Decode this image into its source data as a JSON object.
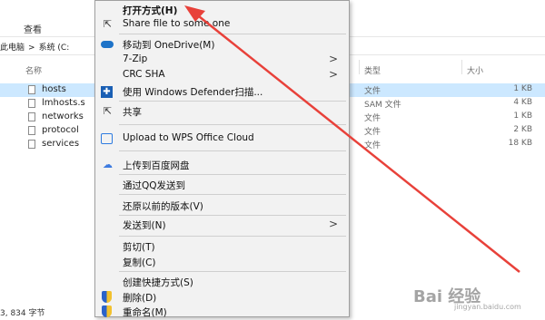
{
  "explorer": {
    "ribbon_tab": "查看",
    "breadcrumb": [
      "此电脑",
      ">",
      "系统 (C:"
    ],
    "columns": {
      "name": "名称",
      "type": "类型",
      "size": "大小"
    },
    "files": [
      {
        "name": "hosts",
        "type": "文件",
        "size": "1 KB",
        "selected": true
      },
      {
        "name": "lmhosts.s",
        "type": "SAM 文件",
        "size": "4 KB",
        "selected": false
      },
      {
        "name": "networks",
        "type": "文件",
        "size": "1 KB",
        "selected": false
      },
      {
        "name": "protocol",
        "type": "文件",
        "size": "2 KB",
        "selected": false
      },
      {
        "name": "services",
        "type": "文件",
        "size": "18 KB",
        "selected": false
      }
    ],
    "status": "3, 834 字节"
  },
  "context_menu": {
    "items": [
      {
        "label": "打开方式(H)",
        "icon": "none",
        "bold": true
      },
      {
        "label": "Share file to some one",
        "icon": "share-icon"
      },
      {
        "label": "移动到 OneDrive(M)",
        "icon": "onedrive-icon"
      },
      {
        "label": "7-Zip",
        "icon": "none",
        "submenu": true
      },
      {
        "label": "CRC SHA",
        "icon": "none",
        "submenu": true
      },
      {
        "label": "使用 Windows Defender扫描...",
        "icon": "defender-icon"
      },
      {
        "label": "共享",
        "icon": "share-icon"
      },
      {
        "label": "Upload to WPS Office Cloud",
        "icon": "wps-cloud-icon"
      },
      {
        "label": "上传到百度网盘",
        "icon": "baidu-cloud-icon"
      },
      {
        "label": "通过QQ发送到",
        "icon": "none"
      },
      {
        "label": "还原以前的版本(V)",
        "icon": "none"
      },
      {
        "label": "发送到(N)",
        "icon": "none",
        "submenu": true
      },
      {
        "label": "剪切(T)",
        "icon": "none"
      },
      {
        "label": "复制(C)",
        "icon": "none"
      },
      {
        "label": "创建快捷方式(S)",
        "icon": "none"
      },
      {
        "label": "删除(D)",
        "icon": "uac-shield-icon"
      },
      {
        "label": "重命名(M)",
        "icon": "uac-shield-icon"
      }
    ],
    "submenu_glyph": ">"
  },
  "watermark": {
    "text": "Bai 经验",
    "sub": "jingyan.baidu.com"
  },
  "colors": {
    "annotation_arrow": "#e8413a",
    "selection": "#cce8ff",
    "menu_bg": "#f2f2f2"
  }
}
